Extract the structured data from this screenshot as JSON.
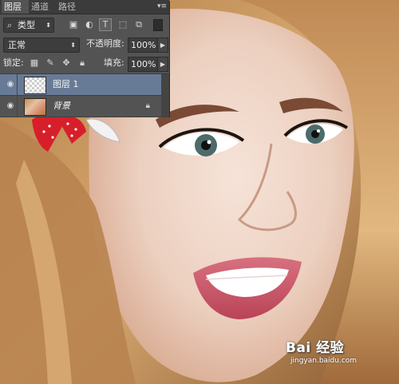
{
  "panel": {
    "tabs": [
      {
        "label": "图层",
        "active": true
      },
      {
        "label": "通道",
        "active": false
      },
      {
        "label": "路径",
        "active": false
      }
    ],
    "menu_icon": "panel-menu-icon",
    "filter": {
      "kind_label": "类型"
    },
    "blend_mode": "正常",
    "opacity_label": "不透明度:",
    "opacity_value": "100%",
    "lock_label": "锁定:",
    "fill_label": "填充:",
    "fill_value": "100%",
    "layers": [
      {
        "name": "图层 1",
        "selected": true,
        "thumbnail": "transparent-checkerboard"
      },
      {
        "name": "背景",
        "selected": false,
        "thumbnail": "photo",
        "locked": true
      }
    ]
  },
  "watermark": {
    "logo_text": "Bai 经验",
    "url": "jingyan.baidu.com"
  },
  "colors": {
    "panel_bg": "#535353",
    "tab_bar": "#3b3b3b",
    "selected_layer": "#687b96"
  }
}
